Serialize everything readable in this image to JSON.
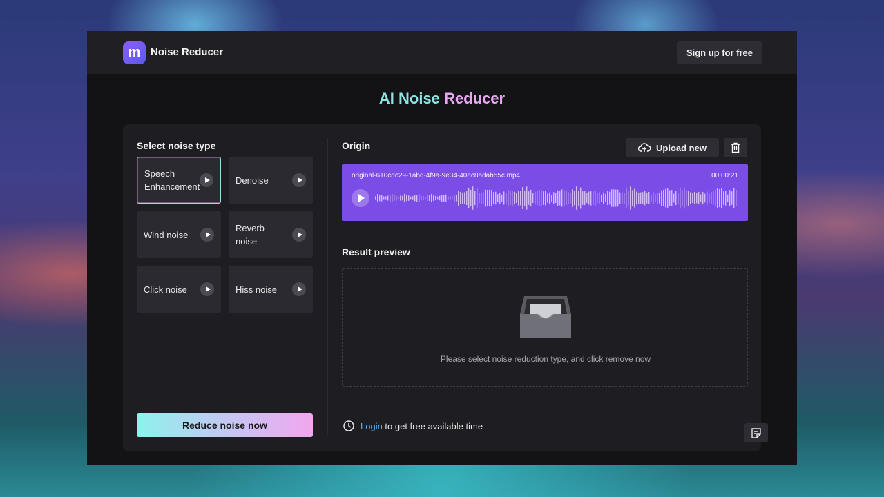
{
  "header": {
    "logo_glyph": "m",
    "brand": "Noise Reducer",
    "signup_label": "Sign up for free"
  },
  "headline": {
    "part1": "AI Noise",
    "part2": "Reducer"
  },
  "left": {
    "section_label": "Select noise type",
    "noise_types": [
      {
        "label": "Speech Enhancement",
        "selected": true
      },
      {
        "label": "Denoise",
        "selected": false
      },
      {
        "label": "Wind noise",
        "selected": false
      },
      {
        "label": "Reverb noise",
        "selected": false
      },
      {
        "label": "Click noise",
        "selected": false
      },
      {
        "label": "Hiss noise",
        "selected": false
      }
    ],
    "reduce_label": "Reduce noise now"
  },
  "origin": {
    "label": "Origin",
    "upload_label": "Upload new",
    "file_name": "original-610cdc29-1abd-4f9a-9e34-40ec8adab55c.mp4",
    "duration": "00:00:21"
  },
  "result": {
    "label": "Result preview",
    "message": "Please select noise reduction type, and click remove now"
  },
  "footer": {
    "login_link": "Login",
    "login_text": " to get free available time"
  },
  "icons": {
    "upload": "cloud-upload-icon",
    "trash": "trash-icon",
    "clock": "clock-icon",
    "feedback": "feedback-icon",
    "play": "play-icon",
    "tray": "empty-tray-icon"
  },
  "colors": {
    "accent_purple": "#7c4ce6",
    "gradient_start": "#8ef2ec",
    "gradient_end": "#f2a6ee",
    "link": "#5ab0f0"
  }
}
